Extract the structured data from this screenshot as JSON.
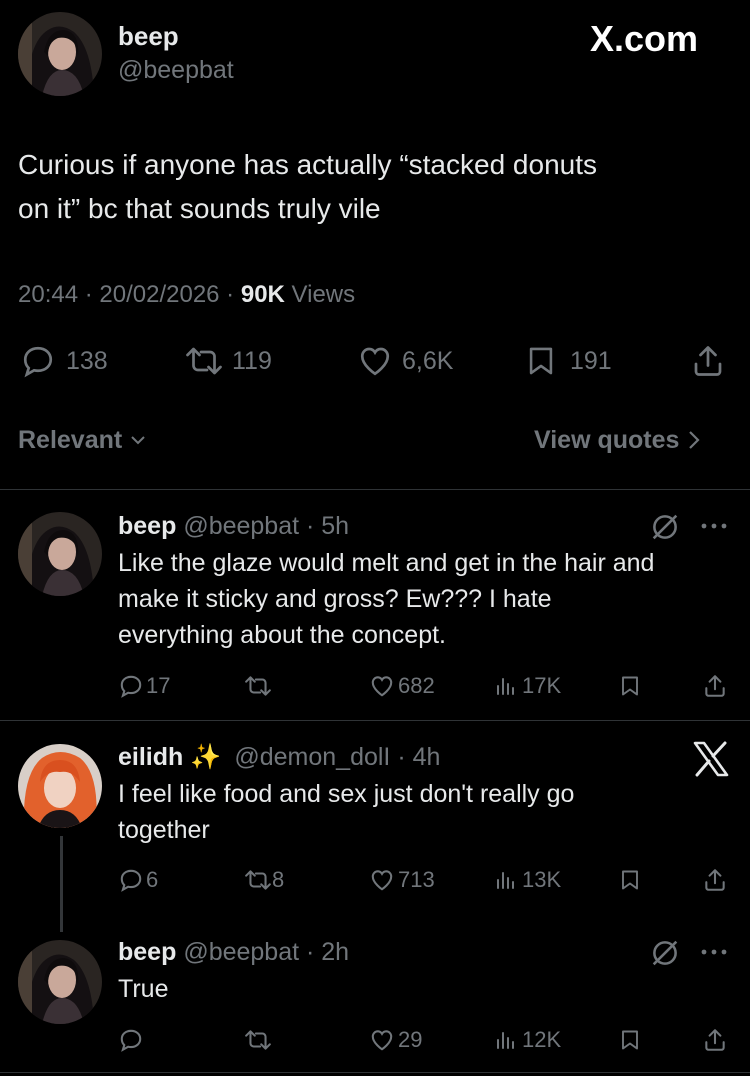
{
  "site_label": "X.com",
  "main_post": {
    "name": "beep",
    "handle": "@beepbat",
    "text_lines": [
      "Curious if anyone has actually “stacked donuts",
      "on it” bc that sounds truly vile"
    ],
    "time": "20:44",
    "date": "20/02/2026",
    "views_count": "90K",
    "views_label": "Views",
    "replies": "138",
    "reposts": "119",
    "likes": "6,6K",
    "bookmarks": "191"
  },
  "sort": {
    "label": "Relevant",
    "view_quotes": "View quotes"
  },
  "replies": [
    {
      "name": "beep",
      "handle": "@beepbat",
      "age": "5h",
      "text_lines": [
        "Like the glaze would melt and get in the hair and",
        "make it sticky and gross? Ew??? I hate",
        "everything about the concept."
      ],
      "replies": "17",
      "reposts": "",
      "likes": "682",
      "views": "17K"
    },
    {
      "name": "eilidh",
      "name_emoji": "✨",
      "handle": "@demon_dolI",
      "age": "4h",
      "text_lines": [
        "I feel like food and sex just don't really go",
        "together"
      ],
      "replies": "6",
      "reposts": "8",
      "likes": "713",
      "views": "13K"
    },
    {
      "name": "beep",
      "handle": "@beepbat",
      "age": "2h",
      "text_lines": [
        "True"
      ],
      "replies": "",
      "reposts": "",
      "likes": "29",
      "views": "12K"
    }
  ],
  "colors": {
    "background": "#000000",
    "text": "#e7e9ea",
    "secondary": "#71767b",
    "divider": "#2f3336"
  }
}
